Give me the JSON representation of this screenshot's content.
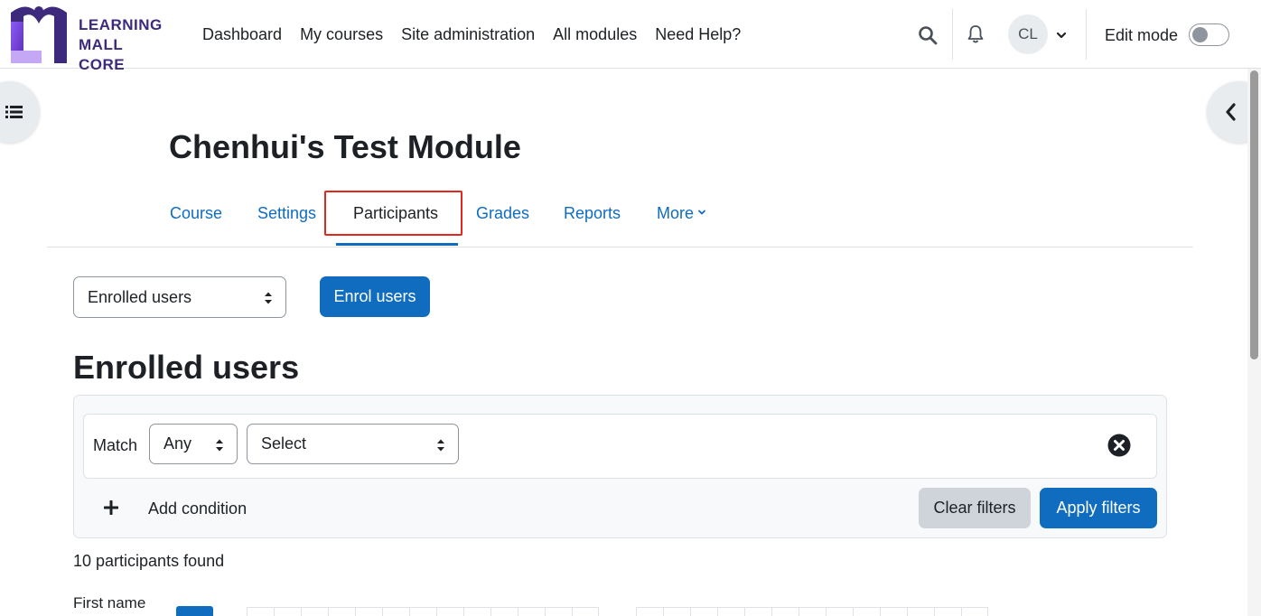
{
  "brand": {
    "logo_lines": [
      "LEARNING",
      "MALL",
      "CORE"
    ],
    "color": "#3d2a7d"
  },
  "navbar": {
    "links": [
      "Dashboard",
      "My courses",
      "Site administration",
      "All modules",
      "Need Help?"
    ],
    "avatar_initials": "CL",
    "edit_mode_label": "Edit mode",
    "edit_mode_on": false,
    "icons": [
      "search-icon",
      "bell-icon",
      "chevron-down-icon"
    ]
  },
  "page": {
    "title": "Chenhui's Test Module"
  },
  "secondary_nav": {
    "tabs": [
      {
        "label": "Course",
        "active": false
      },
      {
        "label": "Settings",
        "active": false
      },
      {
        "label": "Participants",
        "active": true
      },
      {
        "label": "Grades",
        "active": false
      },
      {
        "label": "Reports",
        "active": false
      },
      {
        "label": "More",
        "active": false
      }
    ]
  },
  "controls": {
    "view_select": "Enrolled users",
    "enrol_button": "Enrol users"
  },
  "section": {
    "heading": "Enrolled users"
  },
  "filters": {
    "match_label": "Match",
    "match_value": "Any",
    "type_select": "Select",
    "add_condition": "Add condition",
    "clear_button": "Clear filters",
    "apply_button": "Apply filters"
  },
  "results": {
    "found_text": "10 participants found",
    "first_name_label": "First name"
  },
  "colors": {
    "primary": "#0f6cbf",
    "highlight": "#e0281e",
    "muted_button": "#ced4da"
  }
}
